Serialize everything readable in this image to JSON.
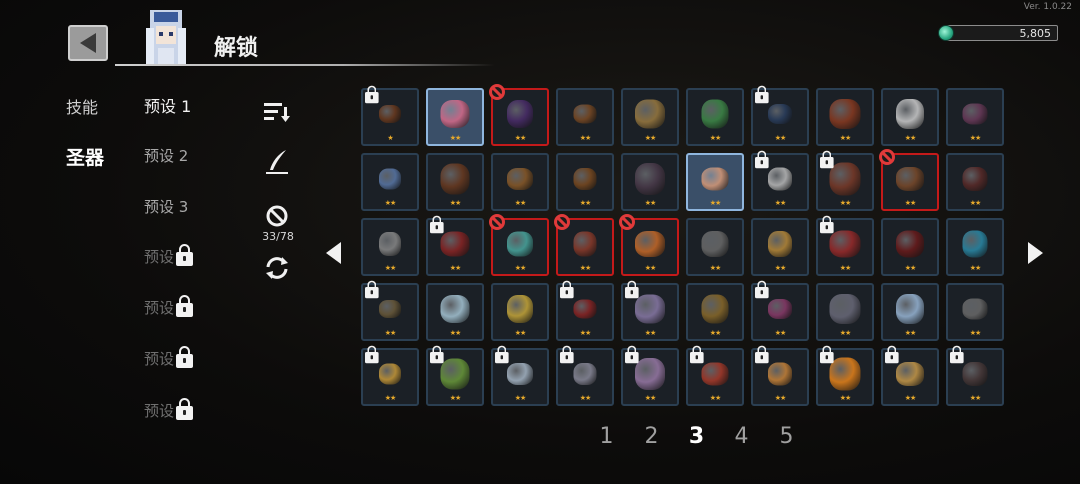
{
  "version": "Ver. 1.0.22",
  "header": {
    "title": "解锁",
    "currency": "5,805"
  },
  "tabs": [
    {
      "label": "技能",
      "active": false
    },
    {
      "label": "圣器",
      "active": true
    }
  ],
  "presets": [
    {
      "label": "预设 1",
      "active": true,
      "locked": false
    },
    {
      "label": "预设 2",
      "active": false,
      "locked": false
    },
    {
      "label": "预设 3",
      "active": false,
      "locked": false
    },
    {
      "label": "预设",
      "active": false,
      "locked": true
    },
    {
      "label": "预设",
      "active": false,
      "locked": true
    },
    {
      "label": "预设",
      "active": false,
      "locked": true
    },
    {
      "label": "预设",
      "active": false,
      "locked": true
    }
  ],
  "tools": {
    "disabled_count": "33/78"
  },
  "icons": [
    "back-arrow-icon",
    "sort-icon",
    "quill-icon",
    "no-entry-icon",
    "refresh-icon",
    "lock-icon",
    "gem-icon",
    "left-arrow-icon",
    "right-arrow-icon"
  ],
  "grid": [
    {
      "state": "locked",
      "stars": "★",
      "color": "#6b3a1e"
    },
    {
      "state": "selected",
      "stars": "★★",
      "color": "#d86a8a"
    },
    {
      "state": "blocked",
      "stars": "★★",
      "color": "#4a2c6a"
    },
    {
      "state": "normal",
      "stars": "★★",
      "color": "#7a4a24"
    },
    {
      "state": "normal",
      "stars": "★★",
      "color": "#9a7a40"
    },
    {
      "state": "normal",
      "stars": "★★",
      "color": "#3e8a48"
    },
    {
      "state": "locked",
      "stars": "★★",
      "color": "#2a3e5e"
    },
    {
      "state": "normal",
      "stars": "★★",
      "color": "#8a3a20"
    },
    {
      "state": "normal",
      "stars": "★★",
      "color": "#cfcfcf"
    },
    {
      "state": "normal",
      "stars": "★★",
      "color": "#6a3a5a"
    },
    {
      "state": "normal",
      "stars": "★★",
      "color": "#5a78a8"
    },
    {
      "state": "normal",
      "stars": "★★",
      "color": "#6a3a20"
    },
    {
      "state": "normal",
      "stars": "★★",
      "color": "#8a5a28"
    },
    {
      "state": "normal",
      "stars": "★★",
      "color": "#7a4a20"
    },
    {
      "state": "normal",
      "stars": "★★",
      "color": "#4a3a4a"
    },
    {
      "state": "selected",
      "stars": "★★",
      "color": "#d89a78"
    },
    {
      "state": "locked",
      "stars": "★★",
      "color": "#bdbdbd"
    },
    {
      "state": "locked",
      "stars": "★★",
      "color": "#7a3a28"
    },
    {
      "state": "blocked",
      "stars": "★★",
      "color": "#7a4a2a"
    },
    {
      "state": "normal",
      "stars": "★★",
      "color": "#5a2a28"
    },
    {
      "state": "normal",
      "stars": "★★",
      "color": "#8a8a8a"
    },
    {
      "state": "locked",
      "stars": "★★",
      "color": "#8a2424"
    },
    {
      "state": "blocked",
      "stars": "★★",
      "color": "#4aa8a0"
    },
    {
      "state": "blocked",
      "stars": "★★",
      "color": "#8a3a2a"
    },
    {
      "state": "blocked",
      "stars": "★★",
      "color": "#c86a28"
    },
    {
      "state": "normal",
      "stars": "★★",
      "color": "#6a6a6a"
    },
    {
      "state": "normal",
      "stars": "★★",
      "color": "#b88a3a"
    },
    {
      "state": "locked",
      "stars": "★★",
      "color": "#9a2a2a"
    },
    {
      "state": "normal",
      "stars": "★★",
      "color": "#6a1a1a"
    },
    {
      "state": "normal",
      "stars": "★★",
      "color": "#2a8aa8"
    },
    {
      "state": "locked",
      "stars": "★★",
      "color": "#6a5a3a"
    },
    {
      "state": "normal",
      "stars": "★★",
      "color": "#a8c8d8"
    },
    {
      "state": "normal",
      "stars": "★★",
      "color": "#c8a83a"
    },
    {
      "state": "locked",
      "stars": "★★",
      "color": "#8a2424"
    },
    {
      "state": "locked",
      "stars": "★★",
      "color": "#8a7aa8"
    },
    {
      "state": "normal",
      "stars": "★★",
      "color": "#8a6a2a"
    },
    {
      "state": "locked",
      "stars": "★★",
      "color": "#8a3a6a"
    },
    {
      "state": "normal",
      "stars": "★★",
      "color": "#6a6a7a"
    },
    {
      "state": "normal",
      "stars": "★★",
      "color": "#9ab8d8"
    },
    {
      "state": "normal",
      "stars": "★★",
      "color": "#6a6a6a"
    },
    {
      "state": "locked",
      "stars": "★★",
      "color": "#c89a3a"
    },
    {
      "state": "locked",
      "stars": "★★",
      "color": "#6a9a3a"
    },
    {
      "state": "locked",
      "stars": "★★",
      "color": "#a8b8c8"
    },
    {
      "state": "locked",
      "stars": "★★",
      "color": "#8a8a9a"
    },
    {
      "state": "locked",
      "stars": "★★",
      "color": "#9a7aa8"
    },
    {
      "state": "locked",
      "stars": "★★",
      "color": "#a83a2a"
    },
    {
      "state": "locked",
      "stars": "★★",
      "color": "#c8843a"
    },
    {
      "state": "locked",
      "stars": "★★",
      "color": "#e8841a"
    },
    {
      "state": "locked",
      "stars": "★★",
      "color": "#c89a4a"
    },
    {
      "state": "locked",
      "stars": "★★",
      "color": "#4a3a3a"
    }
  ],
  "pagination": {
    "pages": [
      "1",
      "2",
      "3",
      "4",
      "5"
    ],
    "active": "3"
  }
}
